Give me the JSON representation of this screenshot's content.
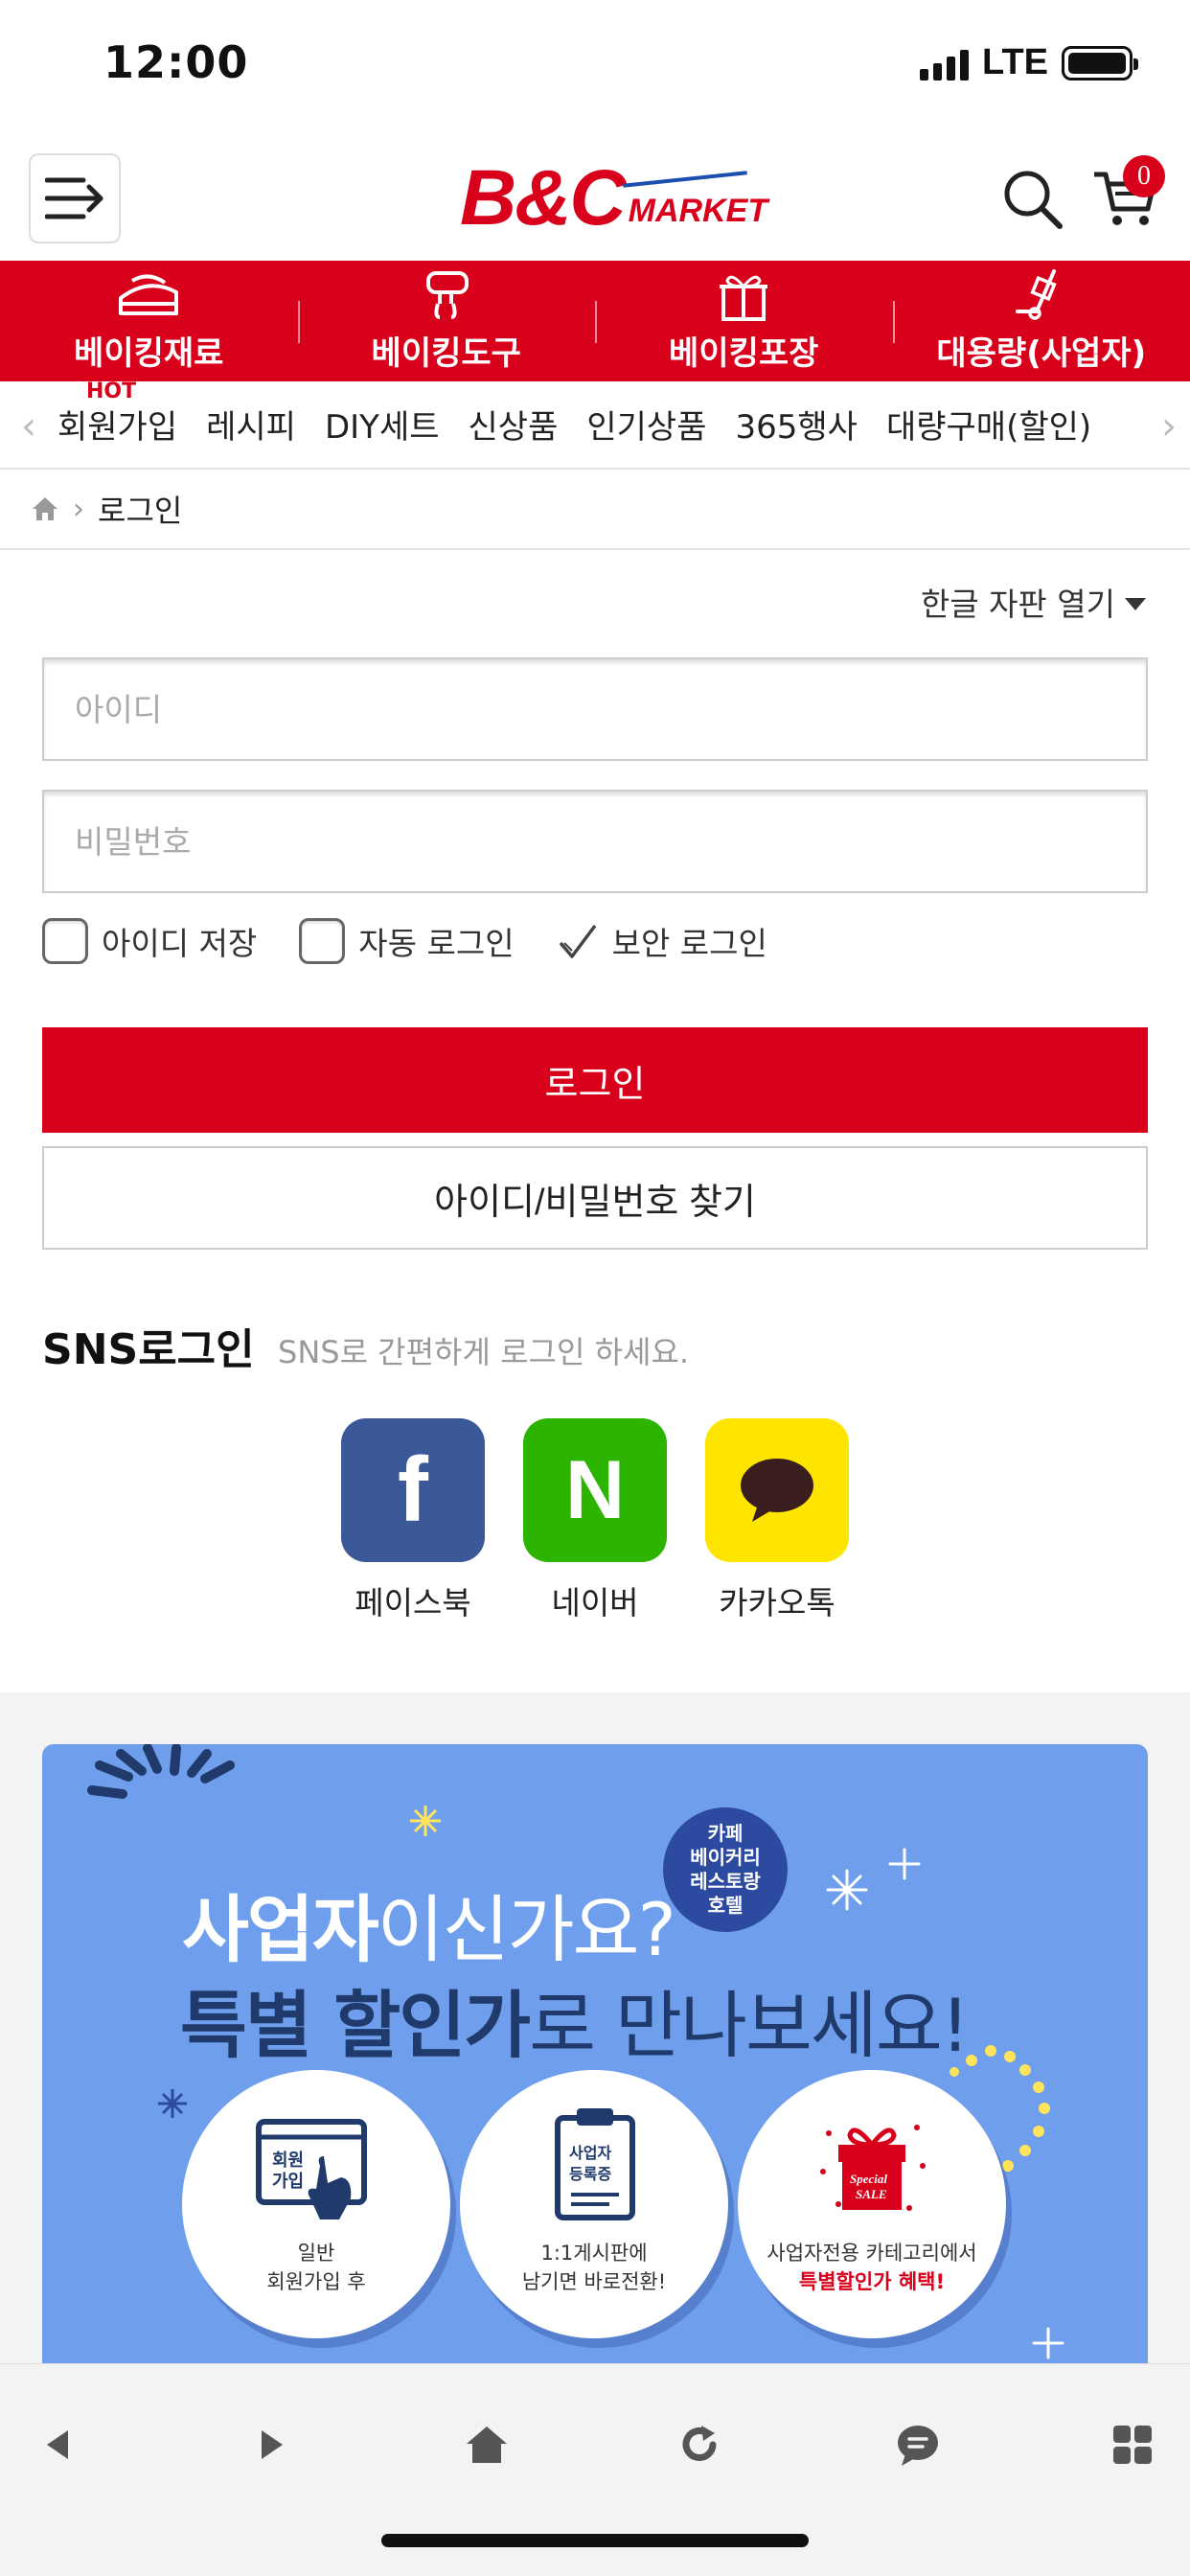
{
  "status_bar": {
    "time": "12:00",
    "network": "LTE"
  },
  "header": {
    "logo_main": "B&C",
    "logo_sub": "MARKET",
    "cart_count": "0"
  },
  "categories": [
    {
      "label": "베이킹재료",
      "icon": "cake-icon"
    },
    {
      "label": "베이킹도구",
      "icon": "mixer-icon"
    },
    {
      "label": "베이킹포장",
      "icon": "gift-box-icon"
    },
    {
      "label": "대용량(사업자)",
      "icon": "hand-truck-icon"
    }
  ],
  "subnav": {
    "hot_badge": "HOT",
    "items": [
      "회원가입",
      "레시피",
      "DIY세트",
      "신상품",
      "인기상품",
      "365행사",
      "대량구매(할인)"
    ]
  },
  "breadcrumb": {
    "current": "로그인"
  },
  "login": {
    "keyboard_toggle": "한글 자판 열기",
    "id_placeholder": "아이디",
    "pw_placeholder": "비밀번호",
    "save_id": "아이디 저장",
    "auto_login": "자동 로그인",
    "secure_login": "보안 로그인",
    "login_button": "로그인",
    "find_button": "아이디/비밀번호 찾기"
  },
  "sns": {
    "title": "SNS로그인",
    "subtitle": "SNS로 간편하게 로그인 하세요.",
    "providers": [
      {
        "label": "페이스북",
        "color": "#3b5998",
        "glyph": "f"
      },
      {
        "label": "네이버",
        "color": "#2db400",
        "glyph": "N"
      },
      {
        "label": "카카오톡",
        "color": "#fee500",
        "glyph": ""
      }
    ]
  },
  "banner": {
    "line1_bold": "사업자",
    "line1_rest": "이신가요?",
    "line2_bold": "특별 할인가",
    "line2_rest": "로 만나보세요!",
    "badge": [
      "카페",
      "베이커리",
      "레스토랑",
      "호텔"
    ],
    "steps": [
      {
        "icon_text": "회원\n가입",
        "line1": "일반",
        "line2": "회원가입 후",
        "line2_red": false
      },
      {
        "icon_text": "사업자\n등록증",
        "line1": "1:1게시판에",
        "line2": "남기면 바로전환!",
        "line2_red": false
      },
      {
        "icon_text": "Special\nSALE",
        "line1": "사업자전용 카테고리에서",
        "line2": "특별할인가 혜택!",
        "line2_red": true
      }
    ]
  },
  "colors": {
    "brand_red": "#d9001b",
    "banner_blue": "#6f9fec"
  }
}
